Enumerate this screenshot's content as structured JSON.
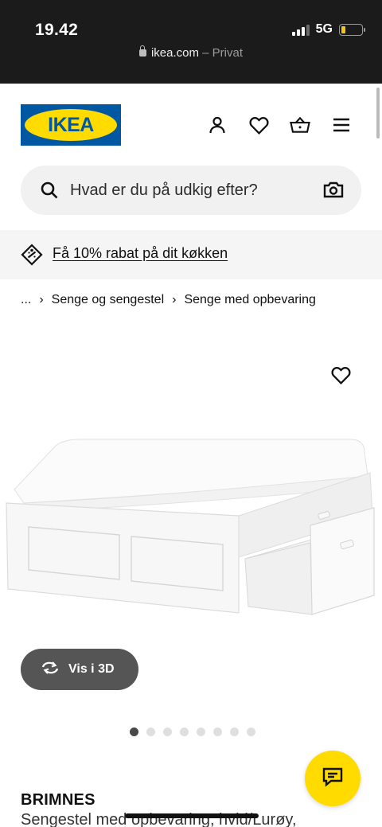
{
  "status_bar": {
    "time": "19.42",
    "network": "5G",
    "url_host": "ikea.com",
    "url_mode": " – Privat"
  },
  "header": {
    "logo_text": "IKEA",
    "icons": [
      "user-icon",
      "heart-icon",
      "basket-icon",
      "menu-icon"
    ]
  },
  "search": {
    "placeholder": "Hvad er du på udkig efter?"
  },
  "promo": {
    "text": "Få 10% rabat på dit køkken"
  },
  "breadcrumb": {
    "items": [
      "...",
      "Senge og sengestel",
      "Senge med opbevaring"
    ]
  },
  "gallery": {
    "view3d_label": "Vis i 3D",
    "slide_count": 8,
    "active_slide": 1
  },
  "product": {
    "name": "BRIMNES",
    "description": "Sengestel med opbevaring, hvid/Lurøy,"
  },
  "colors": {
    "ikea_blue": "#0058a3",
    "ikea_yellow": "#ffdb00",
    "dark_button": "#555555"
  }
}
